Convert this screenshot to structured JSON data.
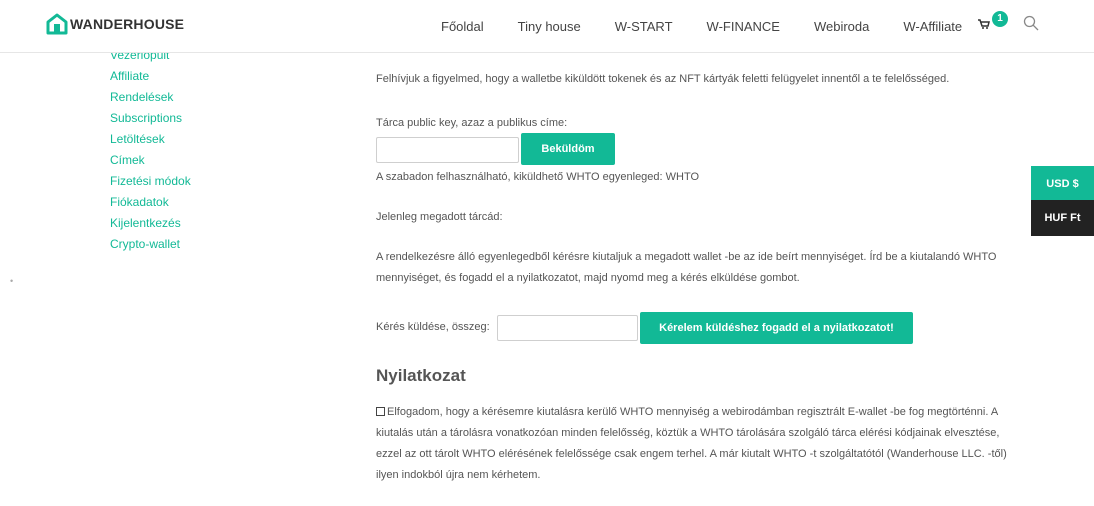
{
  "header": {
    "logo_text": "WANDERHOUSE",
    "nav": [
      "Főoldal",
      "Tiny house",
      "W-START",
      "W-FINANCE",
      "Webiroda",
      "W-Affiliate"
    ],
    "cart_count": "1"
  },
  "sidebar": {
    "items": [
      "Vezérlőpult",
      "Affiliate",
      "Rendelések",
      "Subscriptions",
      "Letöltések",
      "Címek",
      "Fizetési módok",
      "Fiókadatok",
      "Kijelentkezés",
      "Crypto-wallet"
    ],
    "dots": "•"
  },
  "main": {
    "notice": "Felhívjuk a figyelmed, hogy a walletbe kiküldött tokenek és az NFT kártyák feletti felügyelet innentől a te felelősséged.",
    "wallet_label": "Tárca public key, azaz a publikus címe:",
    "wallet_value": "",
    "submit_label": "Beküldöm",
    "balance_text": "A szabadon felhasználható, kiküldhető WHTO egyenleged: WHTO",
    "current_wallet_text": "Jelenleg megadott tárcád:",
    "instructions": "A rendelkezésre álló egyenlegedből kérésre kiutaljuk a megadott wallet -be az ide beírt mennyiséget. Írd be a kiutalandó WHTO mennyiséget, és fogadd el a nyilatkozatot, majd nyomd meg a kérés elküldése gombot.",
    "request_label": "Kérés küldése, összeg:",
    "request_value": "",
    "request_button": "Kérelem küldéshez fogadd el a nyilatkozatot!",
    "declaration_heading": "Nyilatkozat",
    "declaration_text": "Elfogadom, hogy a kérésemre kiutalásra kerülő WHTO mennyiség a webirodámban regisztrált E-wallet -be fog megtörténni. A kiutalás után a tárolásra vonatkozóan minden felelősség, köztük a WHTO tárolására szolgáló tárca elérési kódjainak elvesztése, ezzel az ott tárolt WHTO elérésének felelőssége csak engem terhel. A már kiutalt WHTO -t szolgáltatótól (Wanderhouse LLC. -től) ilyen indokból újra nem kérhetem."
  },
  "currency": {
    "usd": "USD $",
    "huf": "HUF Ft"
  },
  "colors": {
    "accent": "#12b996",
    "dark": "#222222",
    "text": "#555555"
  }
}
